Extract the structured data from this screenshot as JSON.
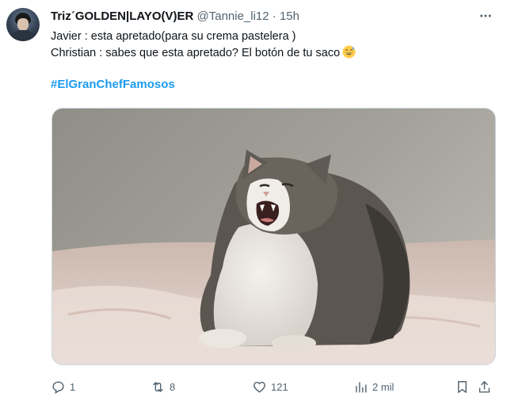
{
  "tweet": {
    "display_name": "Triz´GOLDEN|LAYO(V)ER",
    "handle": "@Tannie_li12",
    "separator": "·",
    "time": "15h",
    "lines": [
      "Javier : esta apretado(para su crema pastelera )",
      "Christian : sabes que esta apretado? El botón de tu saco"
    ],
    "emoji": "grinning-face-with-sweat",
    "hashtag": "#ElGranChefFamosos",
    "media_icon": "crying-cat-photo"
  },
  "actions": {
    "reply_icon": "reply-icon",
    "reply_count": "1",
    "retweet_icon": "retweet-icon",
    "retweet_count": "8",
    "like_icon": "heart-icon",
    "like_count": "121",
    "views_icon": "views-icon",
    "views_count": "2 mil",
    "bookmark_icon": "bookmark-icon",
    "share_icon": "share-icon"
  },
  "colors": {
    "accent": "#1d9bf0",
    "muted": "#536471",
    "text": "#0f1419"
  }
}
